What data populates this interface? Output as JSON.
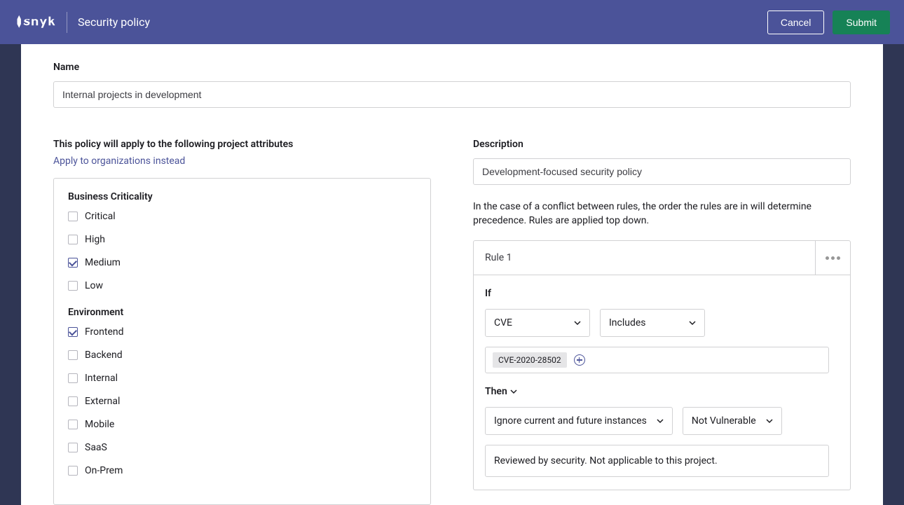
{
  "header": {
    "page_title": "Security policy",
    "cancel_label": "Cancel",
    "submit_label": "Submit"
  },
  "form": {
    "name_label": "Name",
    "name_value": "Internal projects in development"
  },
  "attributes": {
    "section_label": "This policy will apply to the following project attributes",
    "org_link": "Apply to organizations instead",
    "groups": [
      {
        "title": "Business Criticality",
        "items": [
          {
            "label": "Critical",
            "checked": false
          },
          {
            "label": "High",
            "checked": false
          },
          {
            "label": "Medium",
            "checked": true
          },
          {
            "label": "Low",
            "checked": false
          }
        ]
      },
      {
        "title": "Environment",
        "items": [
          {
            "label": "Frontend",
            "checked": true
          },
          {
            "label": "Backend",
            "checked": false
          },
          {
            "label": "Internal",
            "checked": false
          },
          {
            "label": "External",
            "checked": false
          },
          {
            "label": "Mobile",
            "checked": false
          },
          {
            "label": "SaaS",
            "checked": false
          },
          {
            "label": "On-Prem",
            "checked": false
          }
        ]
      }
    ]
  },
  "rules_panel": {
    "description_label": "Description",
    "description_value": "Development-focused security policy",
    "precedence_text": "In the case of a conflict between rules, the order the rules are in will determine precedence. Rules are applied top down.",
    "rule_title": "Rule 1",
    "if_label": "If",
    "condition_type": "CVE",
    "condition_operator": "Includes",
    "condition_value": "CVE-2020-28502",
    "then_label": "Then",
    "action": "Ignore current and future instances",
    "action_value": "Not Vulnerable",
    "reason": "Reviewed by security. Not applicable to this project."
  }
}
